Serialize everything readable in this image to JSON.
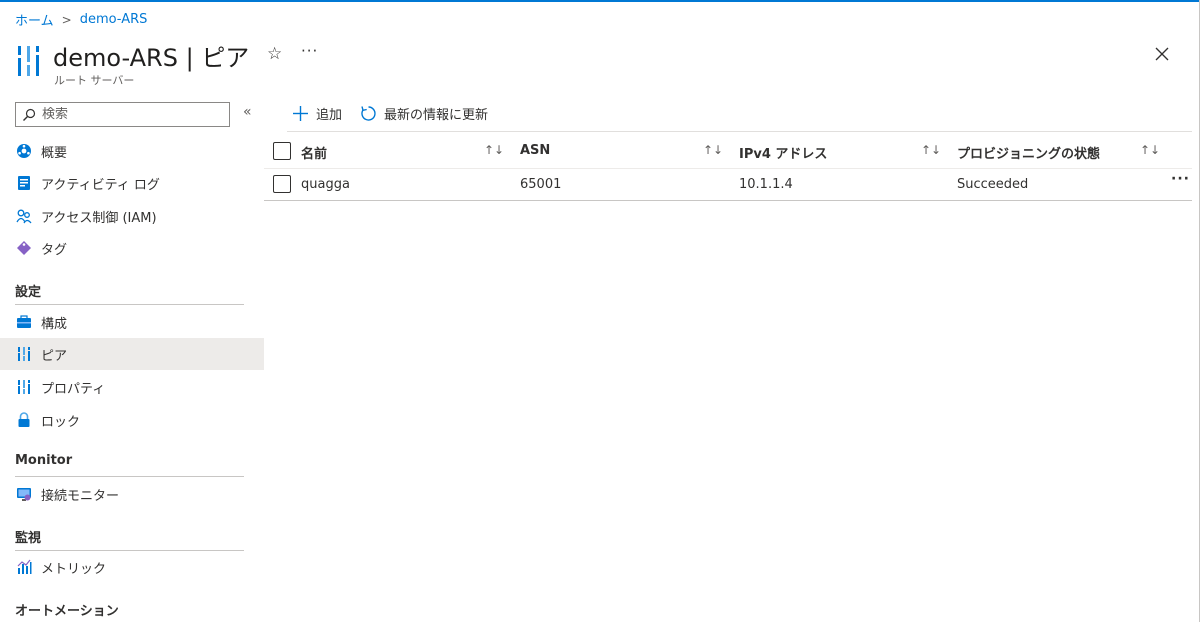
{
  "breadcrumb": {
    "home": "ホーム",
    "current": "demo-ARS"
  },
  "header": {
    "title": "demo-ARS | ピア",
    "subtitle": "ルート サーバー",
    "favorite_icon": "☆",
    "more_label": "···"
  },
  "sidebar": {
    "search_placeholder": "検索",
    "collapse_label": "«",
    "top_items": [
      {
        "label": "概要",
        "icon": "overview-icon"
      },
      {
        "label": "アクティビティ ログ",
        "icon": "activity-log-icon"
      },
      {
        "label": "アクセス制御 (IAM)",
        "icon": "iam-icon"
      },
      {
        "label": "タグ",
        "icon": "tag-icon"
      }
    ],
    "sections": [
      {
        "title": "設定",
        "items": [
          {
            "label": "構成",
            "icon": "configuration-icon"
          },
          {
            "label": "ピア",
            "icon": "peer-icon",
            "active": true
          },
          {
            "label": "プロパティ",
            "icon": "properties-icon"
          },
          {
            "label": "ロック",
            "icon": "lock-icon"
          }
        ]
      },
      {
        "title": "Monitor",
        "items": [
          {
            "label": "接続モニター",
            "icon": "connection-monitor-icon"
          }
        ]
      },
      {
        "title": "監視",
        "items": [
          {
            "label": "メトリック",
            "icon": "metrics-icon"
          }
        ]
      },
      {
        "title": "オートメーション",
        "items": []
      }
    ]
  },
  "toolbar": {
    "add_label": "追加",
    "refresh_label": "最新の情報に更新"
  },
  "table": {
    "columns": [
      "名前",
      "ASN",
      "IPv4 アドレス",
      "プロビジョニングの状態"
    ],
    "sort_icon": "↑↓",
    "rows": [
      {
        "name": "quagga",
        "asn": "65001",
        "ipv4": "10.1.1.4",
        "state": "Succeeded"
      }
    ],
    "row_more_label": "···"
  },
  "colors": {
    "accent": "#0078d4",
    "active_bg": "#edebe9"
  }
}
